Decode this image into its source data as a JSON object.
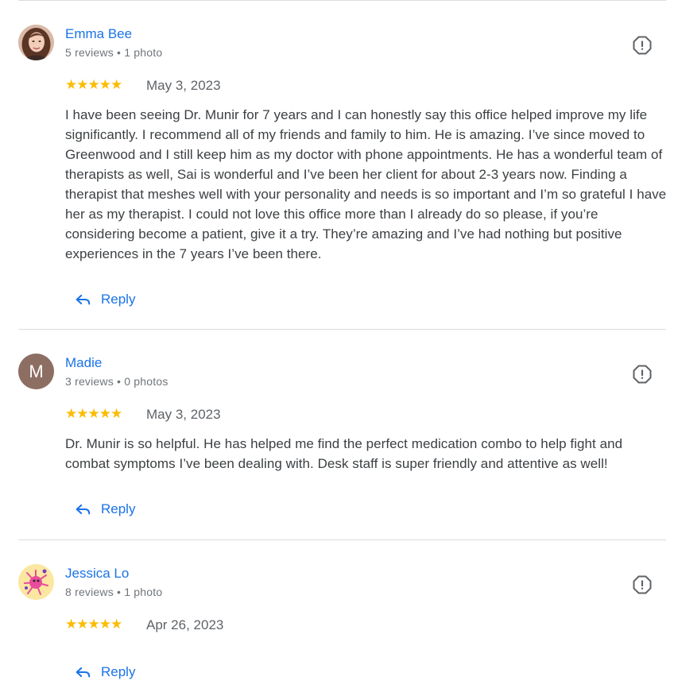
{
  "reviews": [
    {
      "name": "Emma Bee",
      "meta": "5 reviews • 1 photo",
      "rating": 5,
      "stars": "★★★★★",
      "date": "May 3, 2023",
      "text": "I have been seeing Dr. Munir for 7 years and I can honestly say this office helped improve my life significantly. I recommend all of my friends and family to him. He is amazing. I’ve since moved to Greenwood and I still keep him as my doctor with phone appointments. He has a wonderful team of therapists as well, Sai is wonderful and I’ve been her client for about 2-3 years now. Finding a therapist that meshes well with your personality and needs is so important and I’m so grateful I have her as my therapist. I could not love this office more than I already do so please, if you’re considering become a patient, give it a try. They’re amazing and I’ve had nothing but positive experiences in the 7 years I’ve been there.",
      "reply_label": "Reply",
      "avatar": "photo-icon"
    },
    {
      "name": "Madie",
      "meta": "3 reviews • 0 photos",
      "rating": 5,
      "stars": "★★★★★",
      "date": "May 3, 2023",
      "text": "Dr. Munir is so helpful. He has helped me find the perfect medication combo to help fight and combat symptoms I’ve been dealing with. Desk staff is super friendly and attentive as well!",
      "reply_label": "Reply",
      "avatar_initial": "M",
      "avatar_color": "#8d6e63"
    },
    {
      "name": "Jessica Lo",
      "meta": "8 reviews • 1 photo",
      "rating": 5,
      "stars": "★★★★★",
      "date": "Apr 26, 2023",
      "text": "",
      "reply_label": "Reply",
      "avatar": "illustration-icon"
    }
  ],
  "colors": {
    "name_link": "#1a73e8",
    "star": "#fbbc04",
    "meta": "#70757a",
    "divider": "#dadce0"
  },
  "icons": {
    "flag": "report-flag-icon",
    "reply": "reply-arrow-icon"
  }
}
